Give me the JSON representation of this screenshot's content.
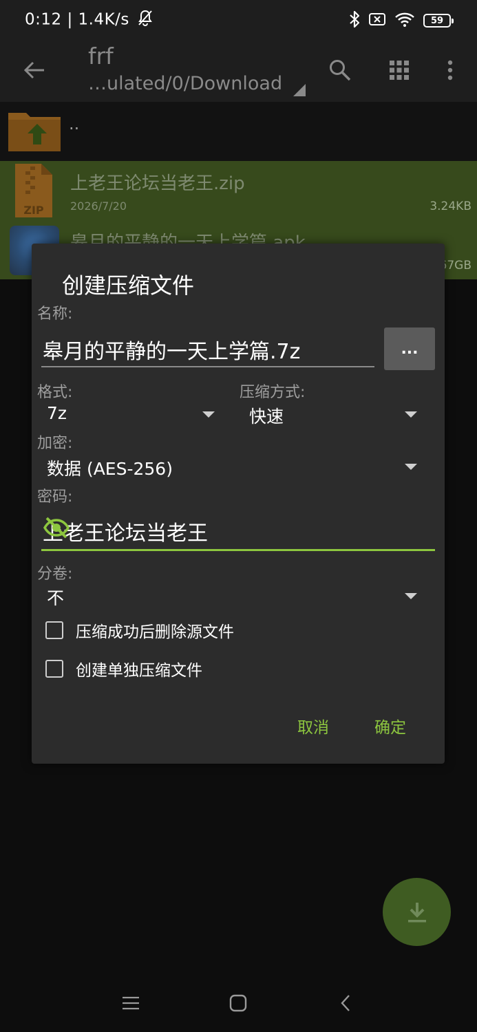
{
  "status_bar": {
    "time_and_speed": "0:12 | 1.4K/s",
    "battery": "59"
  },
  "app_bar": {
    "title": "frf",
    "path": "…ulated/0/Download"
  },
  "file_list": {
    "parent_label": "..",
    "items": [
      {
        "name": "上老王论坛当老王.zip",
        "date": "2026/7/20",
        "size": "3.24KB",
        "icon": "zip-file-icon"
      },
      {
        "name": "皋月的平静的一天上学篇.apk",
        "date": "",
        "size": "67GB",
        "icon": "apk-thumbnail"
      }
    ]
  },
  "dialog": {
    "title": "创建压缩文件",
    "name_label": "名称:",
    "name_value": "皋月的平静的一天上学篇.7z",
    "browse_label": "...",
    "format_label": "格式:",
    "format_value": "7z",
    "method_label": "压缩方式:",
    "method_value": "快速",
    "encryption_label": "加密:",
    "encryption_value": "数据 (AES-256)",
    "password_label": "密码:",
    "password_value": "上老王论坛当老王",
    "volume_label": "分卷:",
    "volume_value": "不",
    "checkboxes": [
      {
        "label": "压缩成功后删除源文件",
        "checked": false
      },
      {
        "label": "创建单独压缩文件",
        "checked": false
      }
    ],
    "cancel_label": "取消",
    "ok_label": "确定"
  },
  "colors": {
    "accent": "#8dc63f",
    "dialog_bg": "#2c2c2c",
    "selected_row": "#374a1c",
    "fab": "#3f5c22"
  }
}
